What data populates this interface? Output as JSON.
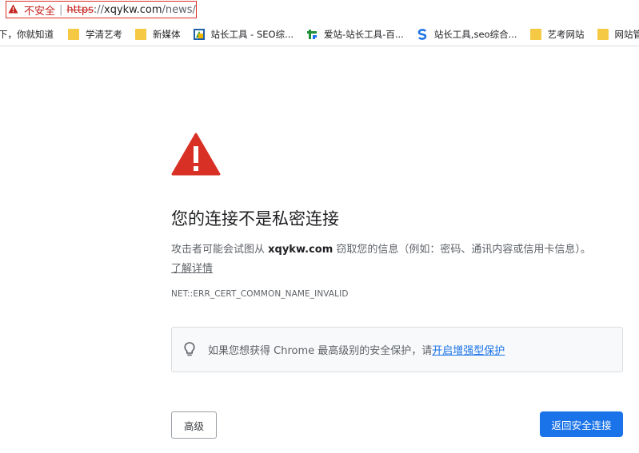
{
  "address_bar": {
    "security_label": "不安全",
    "separator": "|",
    "url_scheme": "https",
    "url_after_scheme": "://",
    "url_host": "xqykw.com",
    "url_path": "/news/"
  },
  "bookmarks": [
    {
      "label": "下，你就知道",
      "icon": "partial-icon"
    },
    {
      "label": "学清艺考",
      "icon": "folder-icon"
    },
    {
      "label": "新媒体",
      "icon": "folder-icon"
    },
    {
      "label": "站长工具 - SEO综...",
      "icon": "site-logo-icon"
    },
    {
      "label": "爱站-站长工具-百...",
      "icon": "aizhan-logo-icon"
    },
    {
      "label": "站长工具,seo综合...",
      "icon": "blue-s-logo-icon"
    },
    {
      "label": "艺考网站",
      "icon": "folder-icon"
    },
    {
      "label": "网站管",
      "icon": "folder-icon"
    }
  ],
  "interstitial": {
    "heading": "您的连接不是私密连接",
    "description_before": "攻击者可能会试图从 ",
    "description_host": "xqykw.com",
    "description_after": " 窃取您的信息（例如：密码、通讯内容或信用卡信息）。",
    "learn_more": "了解详情",
    "error_code": "NET::ERR_CERT_COMMON_NAME_INVALID",
    "protection_text": "如果您想获得 Chrome 最高级别的安全保护，请",
    "protection_link": "开启增强型保护",
    "advanced_button": "高级",
    "back_button": "返回安全连接"
  },
  "colors": {
    "warning_red": "#d93025",
    "accent_blue": "#1a73e8",
    "folder_yellow": "#f6c944"
  }
}
